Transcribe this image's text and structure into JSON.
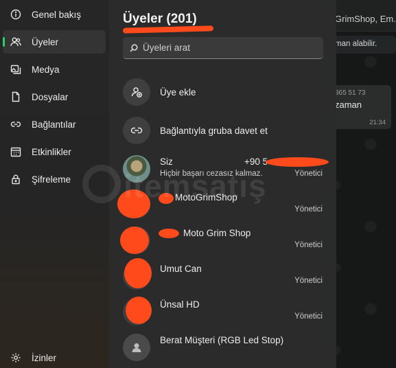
{
  "sidebar": {
    "items": [
      {
        "label": "Genel bakış",
        "icon": "info-icon"
      },
      {
        "label": "Üyeler",
        "icon": "members-icon",
        "active": true
      },
      {
        "label": "Medya",
        "icon": "media-icon"
      },
      {
        "label": "Dosyalar",
        "icon": "file-icon"
      },
      {
        "label": "Bağlantılar",
        "icon": "link-icon"
      },
      {
        "label": "Etkinlikler",
        "icon": "calendar-icon"
      },
      {
        "label": "Şifreleme",
        "icon": "lock-icon"
      }
    ],
    "bottom": {
      "label": "İzinler",
      "icon": "gear-icon"
    }
  },
  "panel": {
    "title": "Üyeler (201)",
    "search_placeholder": "Üyeleri arat",
    "actions": [
      {
        "label": "Üye ekle",
        "icon": "add-person-icon"
      },
      {
        "label": "Bağlantıyla gruba davet et",
        "icon": "link-icon"
      }
    ],
    "members": [
      {
        "name": "Siz",
        "phone": "+90 5",
        "status": "Hiçbir başarı cezasız kalmaz.",
        "role": "Yönetici"
      },
      {
        "name": "MotoGrimShop",
        "role": "Yönetici"
      },
      {
        "name": "Moto Grim Shop",
        "role": "Yönetici"
      },
      {
        "name": "Umut Can",
        "role": "Yönetici"
      },
      {
        "name": "Ünsal HD",
        "role": "Yönetici"
      },
      {
        "name": "Berat Müşteri (RGB Led Stop)",
        "role": ""
      }
    ]
  },
  "chat": {
    "header": "GrimShop, Em...",
    "notice": "man alabilir.",
    "bubble_number": "365 51 73",
    "bubble_text": "zaman",
    "bubble_time": "21:34"
  },
  "watermark": "itemsatış",
  "colors": {
    "accent": "#25d366",
    "redaction": "#ff4a1c"
  }
}
